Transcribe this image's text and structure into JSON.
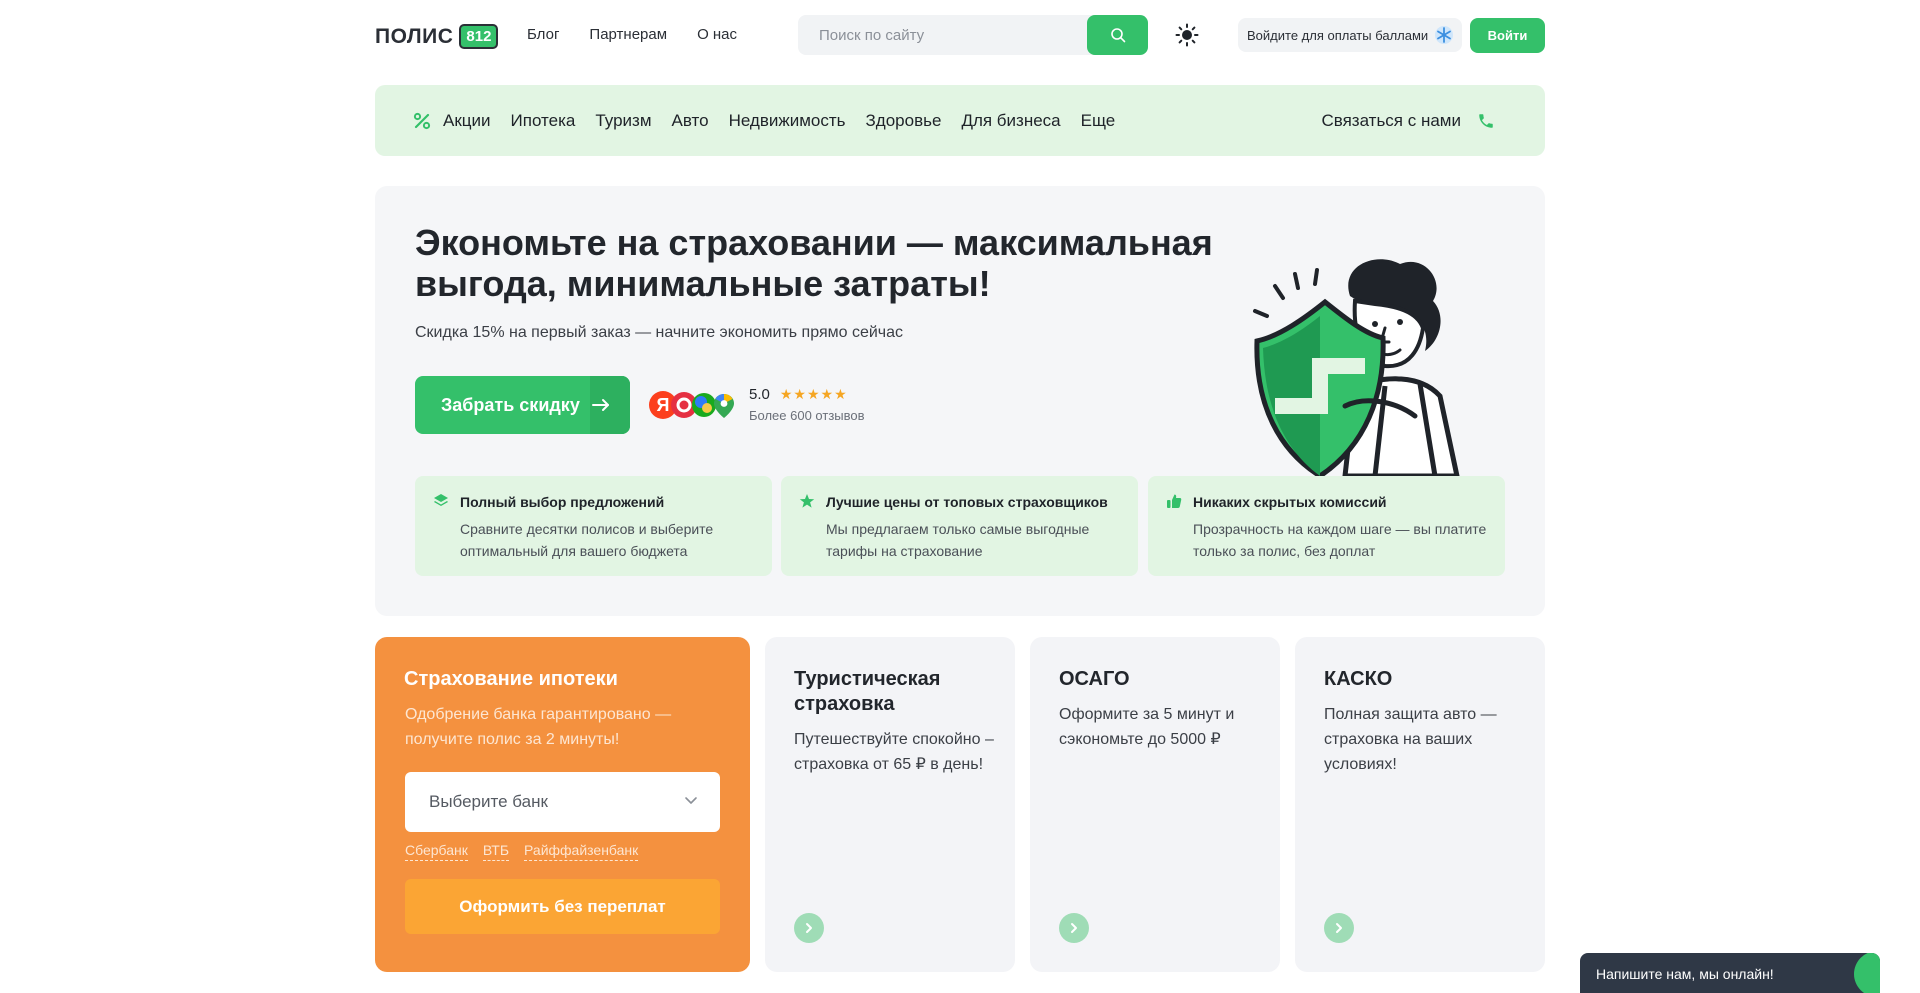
{
  "header": {
    "logo_text": "ПОЛИС",
    "logo_badge": "812",
    "nav": [
      "Блог",
      "Партнерам",
      "О нас"
    ],
    "search_placeholder": "Поиск по сайту",
    "points_label": "Войдите для оплаты баллами",
    "login_label": "Войти"
  },
  "categories": {
    "items": [
      "Акции",
      "Ипотека",
      "Туризм",
      "Авто",
      "Недвижимость",
      "Здоровье",
      "Для бизнеса",
      "Еще"
    ],
    "contact_label": "Связаться с нами"
  },
  "hero": {
    "title": "Экономьте на страховании — максимальная выгода, минимальные затраты!",
    "subtitle": "Скидка 15% на первый заказ — начните экономить прямо сейчас",
    "cta_label": "Забрать скидку",
    "rating_value": "5.0",
    "rating_stars": 5,
    "reviews_label": "Более 600 отзывов",
    "features": [
      {
        "icon": "layers-icon",
        "title": "Полный выбор предложений",
        "text": "Сравните десятки полисов и выберите оптимальный для вашего бюджета"
      },
      {
        "icon": "star-icon",
        "title": "Лучшие цены от топовых страховщиков",
        "text": "Мы предлагаем только самые выгодные тарифы на страхование"
      },
      {
        "icon": "thumbs-up-icon",
        "title": "Никаких скрытых комиссий",
        "text": "Прозрачность на каждом шаге — вы платите только за полис, без доплат"
      }
    ]
  },
  "mortgage": {
    "title": "Страхование ипотеки",
    "subtitle": "Одобрение банка гарантировано — получите полис за 2 минуты!",
    "select_placeholder": "Выберите банк",
    "banks": [
      "Сбербанк",
      "ВТБ",
      "Райффайзенбанк"
    ],
    "button_label": "Оформить без переплат"
  },
  "products": [
    {
      "title": "Туристическая страховка",
      "text": "Путешествуйте спокойно – страховка от 65 ₽ в день!"
    },
    {
      "title": "ОСАГО",
      "text": "Оформите за 5 минут и сэкономьте до 5000 ₽"
    },
    {
      "title": "КАСКО",
      "text": "Полная защита авто — страховка на ваших условиях!"
    }
  ],
  "chat": {
    "label": "Напишите нам, мы онлайн!"
  },
  "colors": {
    "brand_green": "#34c06a",
    "mortgage_orange": "#f4913f",
    "light_green": "#e2f5e3"
  }
}
